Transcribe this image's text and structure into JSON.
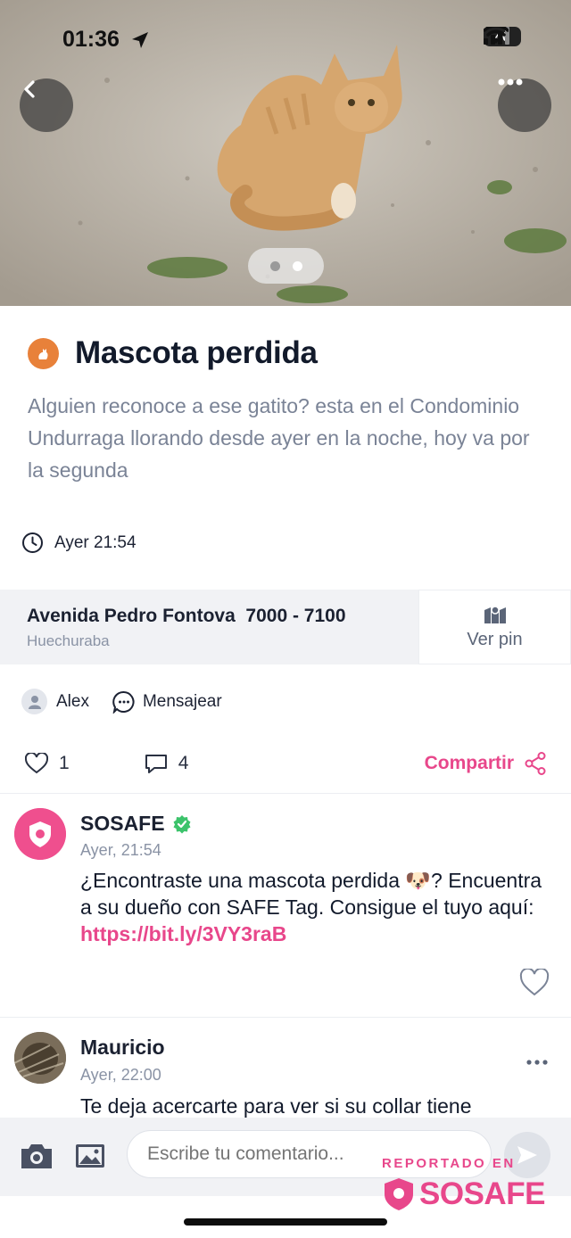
{
  "status_bar": {
    "time": "01:36",
    "battery": "40"
  },
  "hero": {
    "pager_count": 2,
    "active_index": 1
  },
  "post": {
    "category_icon": "cat-icon",
    "title": "Mascota perdida",
    "description": "Alguien reconoce a ese gatito? esta en el Condominio Undurraga llorando desde ayer en la noche, hoy va por la segunda",
    "time": "Ayer 21:54",
    "address": "Avenida Pedro Fontova  7000 - 7100",
    "commune": "Huechuraba",
    "ver_pin_label": "Ver pin",
    "author": "Alex",
    "message_label": "Mensajear",
    "likes": "1",
    "comments": "4",
    "share_label": "Compartir"
  },
  "comments": [
    {
      "author": "SOSAFE",
      "verified": true,
      "time": "Ayer, 21:54",
      "text": "¿Encontraste una mascota perdida 🐶? Encuentra a su dueño con SAFE Tag. Consigue el tuyo aquí: ",
      "link": "https://bit.ly/3VY3raB"
    },
    {
      "author": "Mauricio",
      "time": "Ayer, 22:00",
      "text": "Te deja acercarte para ver si su collar tiene"
    }
  ],
  "composer": {
    "placeholder": "Escribe tu comentario..."
  },
  "watermark": {
    "small": "REPORTADO EN",
    "brand": "SOSAFE"
  },
  "colors": {
    "accent": "#e8478b",
    "text": "#121a2b",
    "muted": "#8a93a5",
    "badge": "#e8813a",
    "verified": "#3cc36b"
  }
}
